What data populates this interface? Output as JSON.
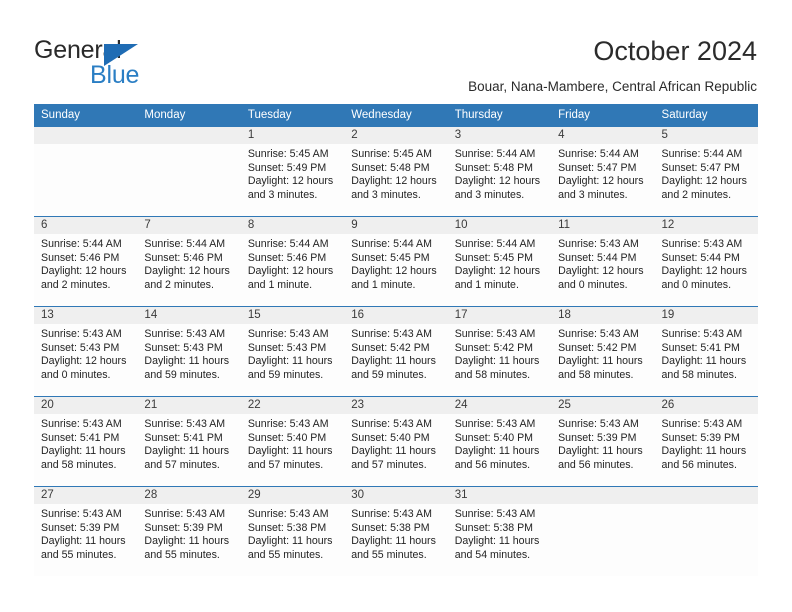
{
  "brand": {
    "name_top": "General",
    "name_bottom": "Blue",
    "triangle_color": "#1f6cb4",
    "blue_text_color": "#2a7ec4"
  },
  "header": {
    "title": "October 2024",
    "subtitle": "Bouar, Nana-Mambere, Central African Republic"
  },
  "theme": {
    "header_row_bg": "#3078b6",
    "header_row_text": "#ffffff",
    "daynum_band_bg": "#efefef",
    "cell_bg": "#fdfdfd",
    "grid_line": "#3078b6"
  },
  "weekday_headers": [
    "Sunday",
    "Monday",
    "Tuesday",
    "Wednesday",
    "Thursday",
    "Friday",
    "Saturday"
  ],
  "weeks": [
    [
      {
        "day": "",
        "sunrise": "",
        "sunset": "",
        "daylight_line1": "",
        "daylight_line2": ""
      },
      {
        "day": "",
        "sunrise": "",
        "sunset": "",
        "daylight_line1": "",
        "daylight_line2": ""
      },
      {
        "day": "1",
        "sunrise": "Sunrise: 5:45 AM",
        "sunset": "Sunset: 5:49 PM",
        "daylight_line1": "Daylight: 12 hours",
        "daylight_line2": "and 3 minutes."
      },
      {
        "day": "2",
        "sunrise": "Sunrise: 5:45 AM",
        "sunset": "Sunset: 5:48 PM",
        "daylight_line1": "Daylight: 12 hours",
        "daylight_line2": "and 3 minutes."
      },
      {
        "day": "3",
        "sunrise": "Sunrise: 5:44 AM",
        "sunset": "Sunset: 5:48 PM",
        "daylight_line1": "Daylight: 12 hours",
        "daylight_line2": "and 3 minutes."
      },
      {
        "day": "4",
        "sunrise": "Sunrise: 5:44 AM",
        "sunset": "Sunset: 5:47 PM",
        "daylight_line1": "Daylight: 12 hours",
        "daylight_line2": "and 3 minutes."
      },
      {
        "day": "5",
        "sunrise": "Sunrise: 5:44 AM",
        "sunset": "Sunset: 5:47 PM",
        "daylight_line1": "Daylight: 12 hours",
        "daylight_line2": "and 2 minutes."
      }
    ],
    [
      {
        "day": "6",
        "sunrise": "Sunrise: 5:44 AM",
        "sunset": "Sunset: 5:46 PM",
        "daylight_line1": "Daylight: 12 hours",
        "daylight_line2": "and 2 minutes."
      },
      {
        "day": "7",
        "sunrise": "Sunrise: 5:44 AM",
        "sunset": "Sunset: 5:46 PM",
        "daylight_line1": "Daylight: 12 hours",
        "daylight_line2": "and 2 minutes."
      },
      {
        "day": "8",
        "sunrise": "Sunrise: 5:44 AM",
        "sunset": "Sunset: 5:46 PM",
        "daylight_line1": "Daylight: 12 hours",
        "daylight_line2": "and 1 minute."
      },
      {
        "day": "9",
        "sunrise": "Sunrise: 5:44 AM",
        "sunset": "Sunset: 5:45 PM",
        "daylight_line1": "Daylight: 12 hours",
        "daylight_line2": "and 1 minute."
      },
      {
        "day": "10",
        "sunrise": "Sunrise: 5:44 AM",
        "sunset": "Sunset: 5:45 PM",
        "daylight_line1": "Daylight: 12 hours",
        "daylight_line2": "and 1 minute."
      },
      {
        "day": "11",
        "sunrise": "Sunrise: 5:43 AM",
        "sunset": "Sunset: 5:44 PM",
        "daylight_line1": "Daylight: 12 hours",
        "daylight_line2": "and 0 minutes."
      },
      {
        "day": "12",
        "sunrise": "Sunrise: 5:43 AM",
        "sunset": "Sunset: 5:44 PM",
        "daylight_line1": "Daylight: 12 hours",
        "daylight_line2": "and 0 minutes."
      }
    ],
    [
      {
        "day": "13",
        "sunrise": "Sunrise: 5:43 AM",
        "sunset": "Sunset: 5:43 PM",
        "daylight_line1": "Daylight: 12 hours",
        "daylight_line2": "and 0 minutes."
      },
      {
        "day": "14",
        "sunrise": "Sunrise: 5:43 AM",
        "sunset": "Sunset: 5:43 PM",
        "daylight_line1": "Daylight: 11 hours",
        "daylight_line2": "and 59 minutes."
      },
      {
        "day": "15",
        "sunrise": "Sunrise: 5:43 AM",
        "sunset": "Sunset: 5:43 PM",
        "daylight_line1": "Daylight: 11 hours",
        "daylight_line2": "and 59 minutes."
      },
      {
        "day": "16",
        "sunrise": "Sunrise: 5:43 AM",
        "sunset": "Sunset: 5:42 PM",
        "daylight_line1": "Daylight: 11 hours",
        "daylight_line2": "and 59 minutes."
      },
      {
        "day": "17",
        "sunrise": "Sunrise: 5:43 AM",
        "sunset": "Sunset: 5:42 PM",
        "daylight_line1": "Daylight: 11 hours",
        "daylight_line2": "and 58 minutes."
      },
      {
        "day": "18",
        "sunrise": "Sunrise: 5:43 AM",
        "sunset": "Sunset: 5:42 PM",
        "daylight_line1": "Daylight: 11 hours",
        "daylight_line2": "and 58 minutes."
      },
      {
        "day": "19",
        "sunrise": "Sunrise: 5:43 AM",
        "sunset": "Sunset: 5:41 PM",
        "daylight_line1": "Daylight: 11 hours",
        "daylight_line2": "and 58 minutes."
      }
    ],
    [
      {
        "day": "20",
        "sunrise": "Sunrise: 5:43 AM",
        "sunset": "Sunset: 5:41 PM",
        "daylight_line1": "Daylight: 11 hours",
        "daylight_line2": "and 58 minutes."
      },
      {
        "day": "21",
        "sunrise": "Sunrise: 5:43 AM",
        "sunset": "Sunset: 5:41 PM",
        "daylight_line1": "Daylight: 11 hours",
        "daylight_line2": "and 57 minutes."
      },
      {
        "day": "22",
        "sunrise": "Sunrise: 5:43 AM",
        "sunset": "Sunset: 5:40 PM",
        "daylight_line1": "Daylight: 11 hours",
        "daylight_line2": "and 57 minutes."
      },
      {
        "day": "23",
        "sunrise": "Sunrise: 5:43 AM",
        "sunset": "Sunset: 5:40 PM",
        "daylight_line1": "Daylight: 11 hours",
        "daylight_line2": "and 57 minutes."
      },
      {
        "day": "24",
        "sunrise": "Sunrise: 5:43 AM",
        "sunset": "Sunset: 5:40 PM",
        "daylight_line1": "Daylight: 11 hours",
        "daylight_line2": "and 56 minutes."
      },
      {
        "day": "25",
        "sunrise": "Sunrise: 5:43 AM",
        "sunset": "Sunset: 5:39 PM",
        "daylight_line1": "Daylight: 11 hours",
        "daylight_line2": "and 56 minutes."
      },
      {
        "day": "26",
        "sunrise": "Sunrise: 5:43 AM",
        "sunset": "Sunset: 5:39 PM",
        "daylight_line1": "Daylight: 11 hours",
        "daylight_line2": "and 56 minutes."
      }
    ],
    [
      {
        "day": "27",
        "sunrise": "Sunrise: 5:43 AM",
        "sunset": "Sunset: 5:39 PM",
        "daylight_line1": "Daylight: 11 hours",
        "daylight_line2": "and 55 minutes."
      },
      {
        "day": "28",
        "sunrise": "Sunrise: 5:43 AM",
        "sunset": "Sunset: 5:39 PM",
        "daylight_line1": "Daylight: 11 hours",
        "daylight_line2": "and 55 minutes."
      },
      {
        "day": "29",
        "sunrise": "Sunrise: 5:43 AM",
        "sunset": "Sunset: 5:38 PM",
        "daylight_line1": "Daylight: 11 hours",
        "daylight_line2": "and 55 minutes."
      },
      {
        "day": "30",
        "sunrise": "Sunrise: 5:43 AM",
        "sunset": "Sunset: 5:38 PM",
        "daylight_line1": "Daylight: 11 hours",
        "daylight_line2": "and 55 minutes."
      },
      {
        "day": "31",
        "sunrise": "Sunrise: 5:43 AM",
        "sunset": "Sunset: 5:38 PM",
        "daylight_line1": "Daylight: 11 hours",
        "daylight_line2": "and 54 minutes."
      },
      {
        "day": "",
        "sunrise": "",
        "sunset": "",
        "daylight_line1": "",
        "daylight_line2": ""
      },
      {
        "day": "",
        "sunrise": "",
        "sunset": "",
        "daylight_line1": "",
        "daylight_line2": ""
      }
    ]
  ]
}
